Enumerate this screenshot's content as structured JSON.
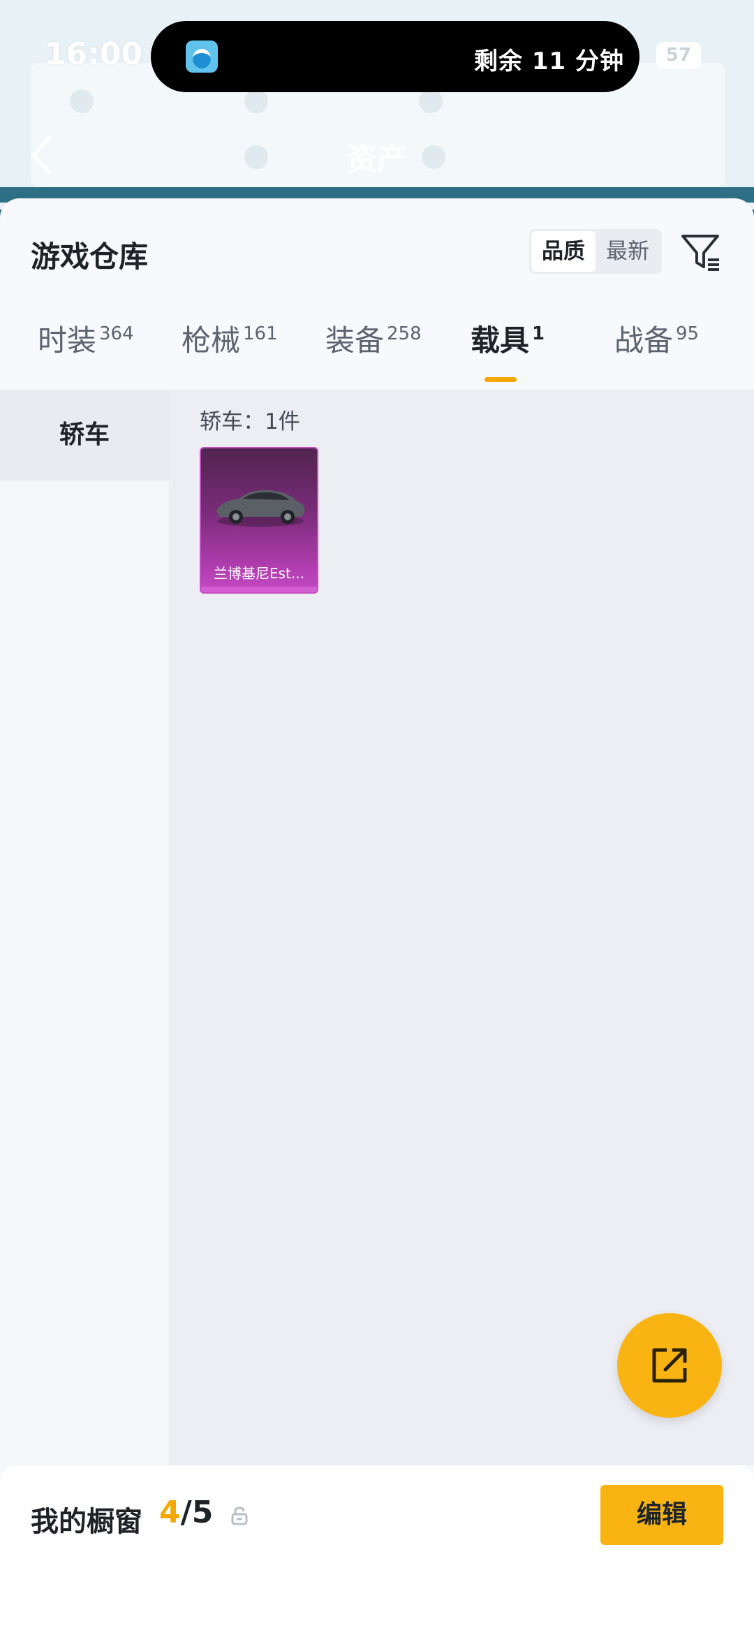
{
  "status_bar": {
    "time": "16:00",
    "battery": "57",
    "island_text": "剩余 11 分钟"
  },
  "background_page": {
    "title": "资产"
  },
  "sheet": {
    "title": "游戏仓库",
    "sort_options": [
      "品质",
      "最新"
    ],
    "sort_active": "品质"
  },
  "tabs": [
    {
      "label": "时装",
      "count": "364"
    },
    {
      "label": "枪械",
      "count": "161"
    },
    {
      "label": "装备",
      "count": "258"
    },
    {
      "label": "载具",
      "count": "1"
    },
    {
      "label": "战备",
      "count": "95"
    }
  ],
  "active_tab": "载具",
  "left_categories": [
    "轿车"
  ],
  "content": {
    "group_label": "轿车：1件",
    "items": [
      {
        "name": "兰博基尼Est..."
      }
    ]
  },
  "showcase": {
    "title": "我的橱窗",
    "current": "4",
    "total": "/5",
    "edit_label": "编辑"
  },
  "colors": {
    "accent": "#f9b414",
    "item_rarity": "#b43fb3"
  }
}
